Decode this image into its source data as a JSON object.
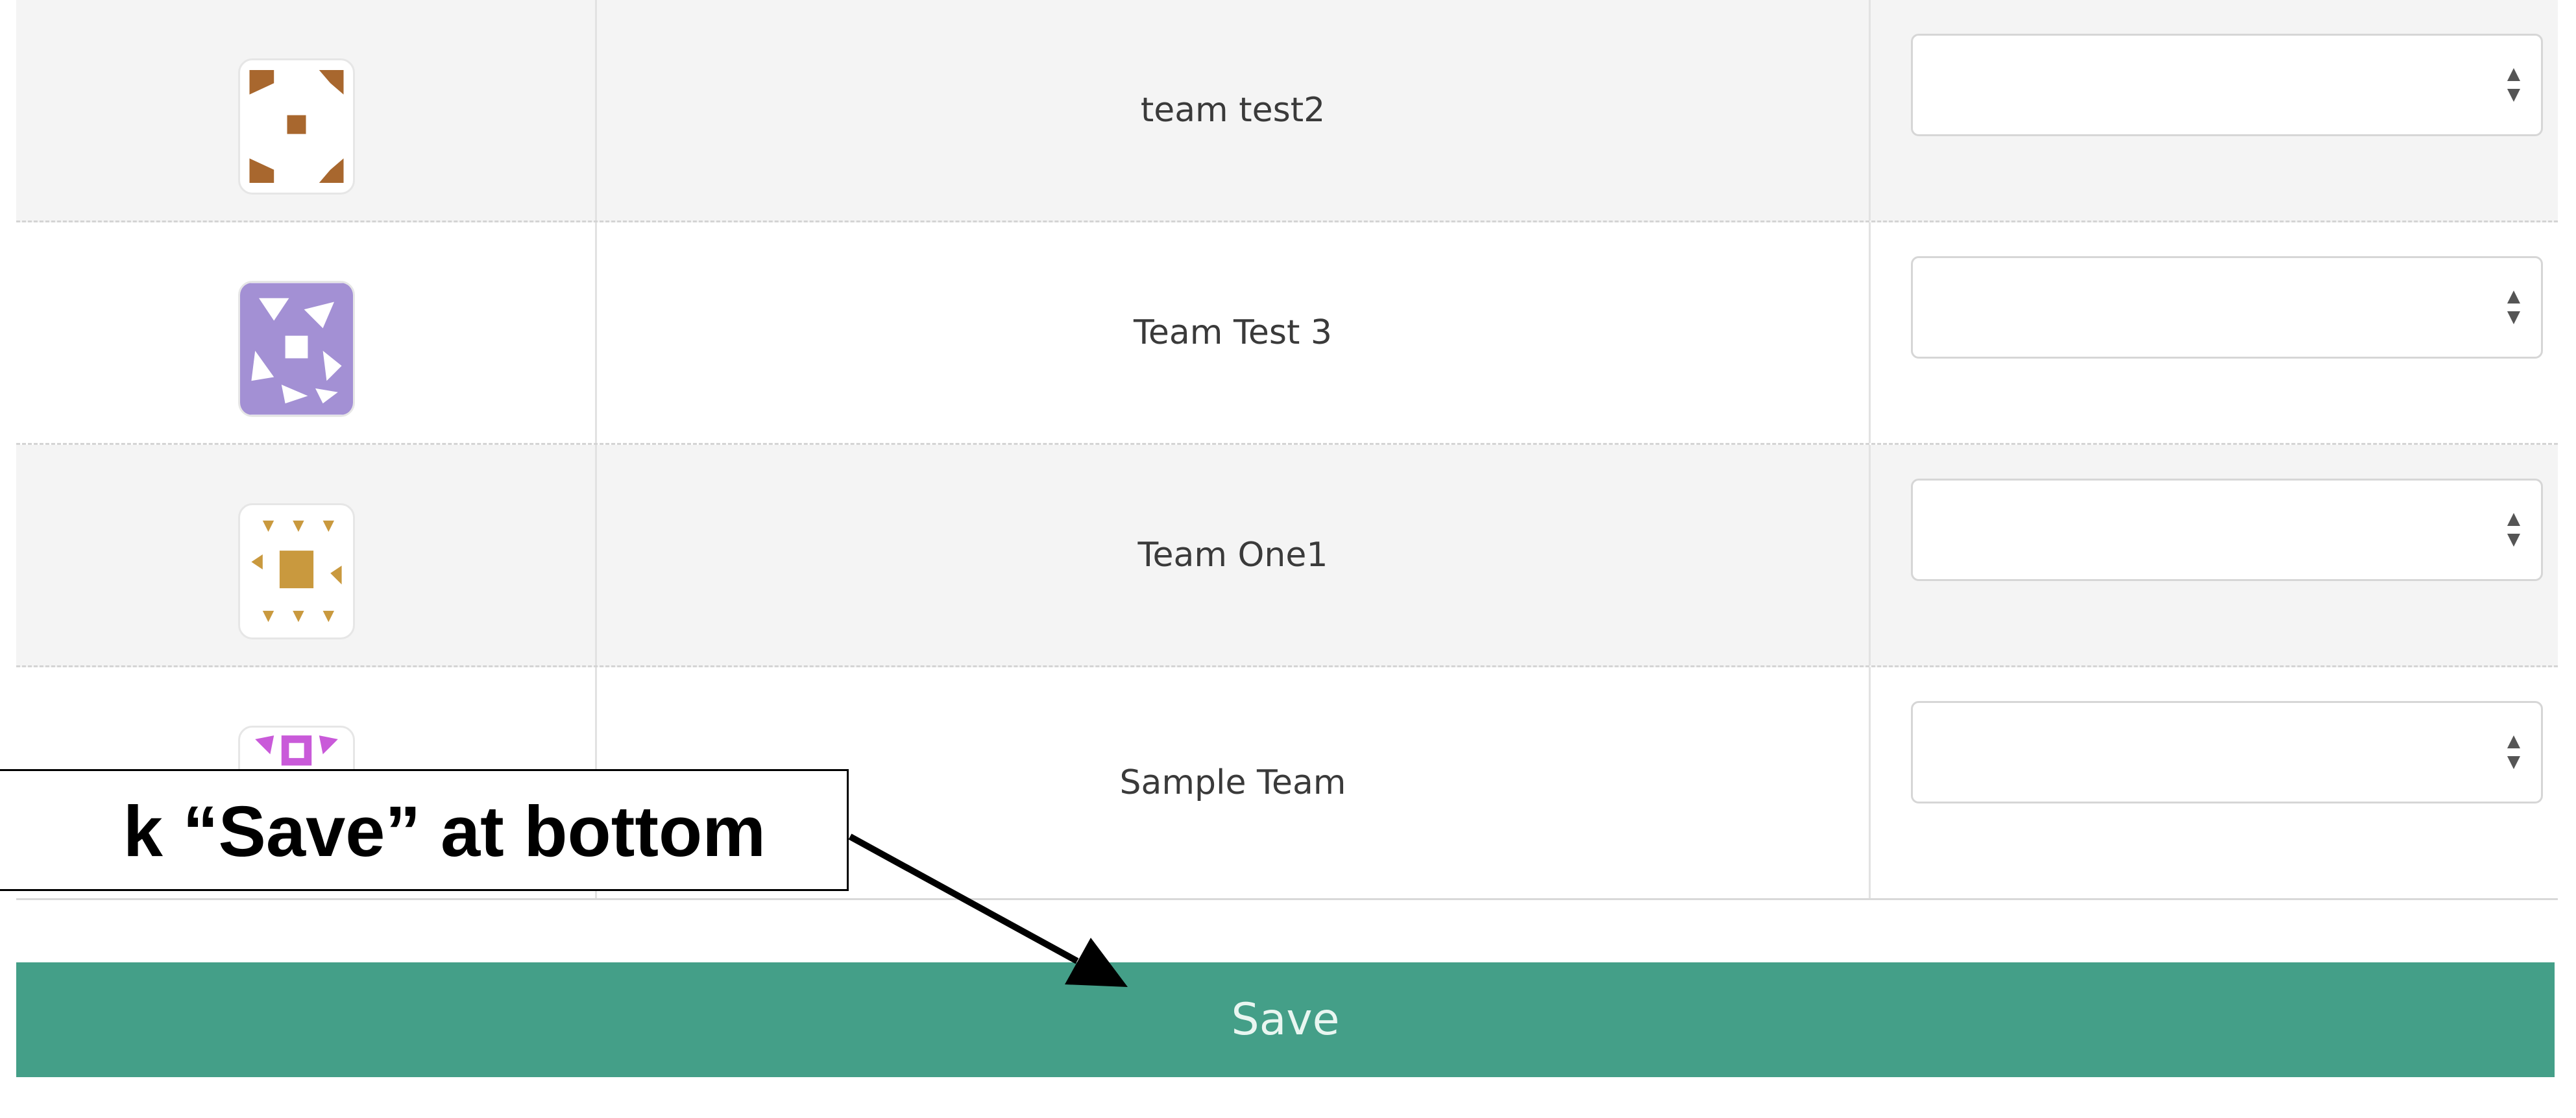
{
  "teams": [
    {
      "name": "team test2",
      "icon": "identicon-brown-avatar",
      "select_value": ""
    },
    {
      "name": "Team Test 3",
      "icon": "identicon-purple-avatar",
      "select_value": ""
    },
    {
      "name": "Team One1",
      "icon": "identicon-gold-avatar",
      "select_value": ""
    },
    {
      "name": "Sample Team",
      "icon": "identicon-magenta-avatar",
      "select_value": ""
    }
  ],
  "save_button": {
    "label": "Save"
  },
  "annotation": {
    "text": "k “Save” at bottom"
  },
  "colors": {
    "save_button_bg": "#449f88",
    "row_shaded": "#f4f4f4",
    "avatar_brown": "#a8672e",
    "avatar_purple": "#a390d4",
    "avatar_gold": "#c9993e",
    "avatar_magenta": "#c95ad9"
  }
}
